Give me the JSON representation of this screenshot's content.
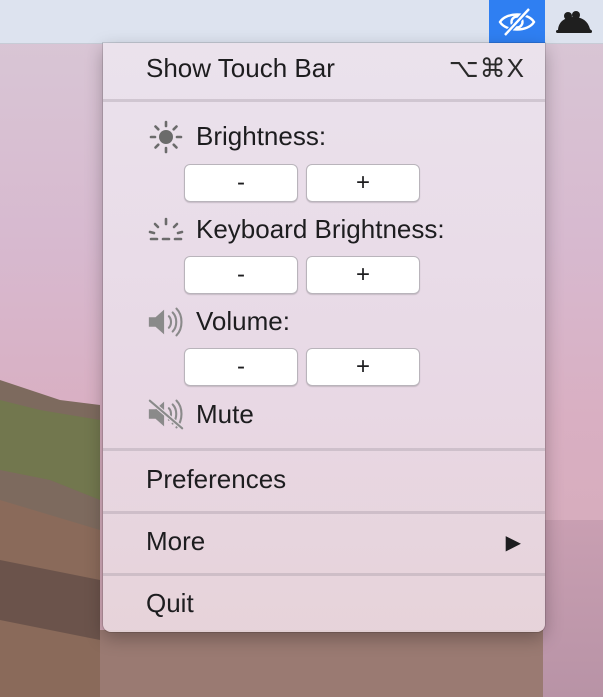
{
  "menu_bar": {
    "eye_icon": "eye-slash-icon",
    "mouse_icon": "mouse-icon",
    "highlight_color": "#2f7ff2"
  },
  "menu": {
    "show_touch_bar": {
      "label": "Show Touch Bar",
      "shortcut": "⌥⌘X"
    },
    "brightness": {
      "label": "Brightness:",
      "icon": "sun-icon",
      "minus": "-",
      "plus": "+"
    },
    "keyboard_brightness": {
      "label": "Keyboard Brightness:",
      "icon": "keyboard-brightness-icon",
      "minus": "-",
      "plus": "+"
    },
    "volume": {
      "label": "Volume:",
      "icon": "speaker-icon",
      "minus": "-",
      "plus": "+"
    },
    "mute": {
      "label": "Mute",
      "icon": "speaker-muted-icon"
    },
    "preferences": {
      "label": "Preferences"
    },
    "more": {
      "label": "More",
      "arrow": "▶"
    },
    "quit": {
      "label": "Quit"
    }
  }
}
